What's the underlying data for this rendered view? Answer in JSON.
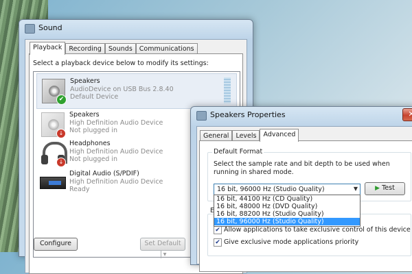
{
  "sound_window": {
    "title": "Sound",
    "tabs": [
      {
        "label": "Playback",
        "active": true
      },
      {
        "label": "Recording",
        "active": false
      },
      {
        "label": "Sounds",
        "active": false
      },
      {
        "label": "Communications",
        "active": false
      }
    ],
    "instruction": "Select a playback device below to modify its settings:",
    "devices": [
      {
        "name": "Speakers",
        "line2": "AudioDevice on USB Bus 2.8.40",
        "line3": "Default Device",
        "icon": "speaker-icon",
        "status": "default-check-icon"
      },
      {
        "name": "Speakers",
        "line2": "High Definition Audio Device",
        "line3": "Not plugged in",
        "icon": "speaker-icon",
        "status": "unplugged-icon"
      },
      {
        "name": "Headphones",
        "line2": "High Definition Audio Device",
        "line3": "Not plugged in",
        "icon": "headphones-icon",
        "status": "unplugged-icon"
      },
      {
        "name": "Digital Audio (S/PDIF)",
        "line2": "High Definition Audio Device",
        "line3": "Ready",
        "icon": "digital-audio-icon",
        "status": ""
      }
    ],
    "configure_label": "Configure",
    "set_default_label": "Set Default"
  },
  "properties_window": {
    "title": "Speakers Properties",
    "close_glyph": "✕",
    "tabs": [
      {
        "label": "General",
        "active": false
      },
      {
        "label": "Levels",
        "active": false
      },
      {
        "label": "Advanced",
        "active": true
      }
    ],
    "group_title": "Default Format",
    "description": "Select the sample rate and bit depth to be used when running in shared mode.",
    "selected_format": "16 bit, 96000 Hz (Studio Quality)",
    "format_options": [
      "16 bit, 44100 Hz (CD Quality)",
      "16 bit, 48000 Hz (DVD Quality)",
      "16 bit, 88200 Hz (Studio Quality)",
      "16 bit, 96000 Hz (Studio Quality)"
    ],
    "highlighted_option_index": 3,
    "test_label": "Test",
    "fragment_text": "E",
    "exclusive_options": [
      {
        "label": "Allow applications to take exclusive control of this device",
        "checked": true
      },
      {
        "label": "Give exclusive mode applications priority",
        "checked": true
      }
    ]
  },
  "colors": {
    "selection": "#3399ff",
    "unplugged": "#c9392b",
    "default_ok": "#2fa12f"
  }
}
